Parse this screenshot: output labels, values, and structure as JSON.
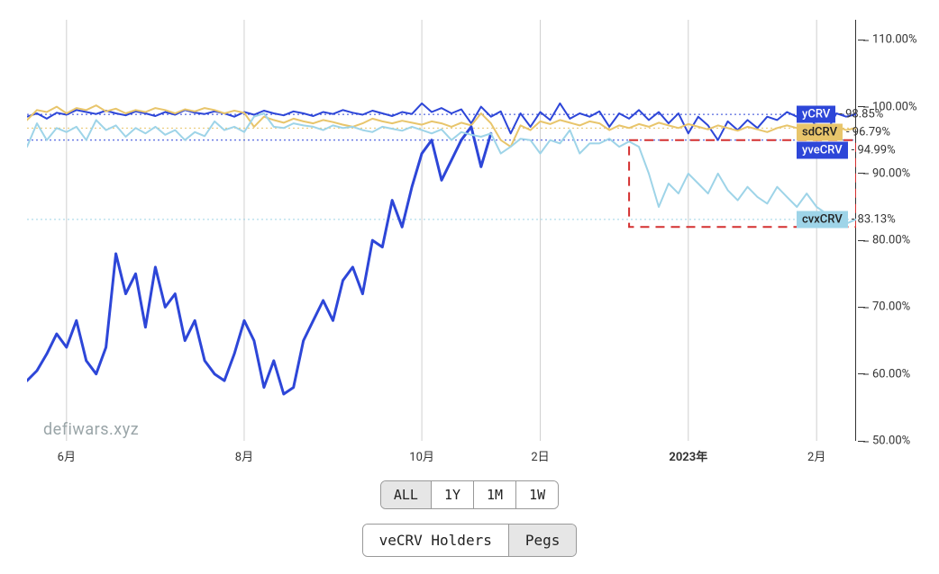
{
  "watermark": "defiwars.xyz",
  "axes": {
    "y": {
      "ticks": [
        {
          "v": 110,
          "label": "110.00%"
        },
        {
          "v": 100,
          "label": "100.00%"
        },
        {
          "v": 90,
          "label": "90.00%"
        },
        {
          "v": 80,
          "label": "80.00%"
        },
        {
          "v": 70,
          "label": "70.00%"
        },
        {
          "v": 60,
          "label": "60.00%"
        },
        {
          "v": 50,
          "label": "50.00%"
        }
      ],
      "min": 50,
      "max": 113
    },
    "x": {
      "ticks": [
        {
          "i": 4,
          "label": "6月"
        },
        {
          "i": 22,
          "label": "8月"
        },
        {
          "i": 40,
          "label": "10月"
        },
        {
          "i": 52,
          "label": "2日"
        },
        {
          "i": 67,
          "label": "2023年",
          "bold": true
        },
        {
          "i": 80,
          "label": "2月"
        }
      ],
      "grid_i": [
        4,
        22,
        40,
        52,
        67,
        80
      ],
      "n": 85
    }
  },
  "annotation_box": {
    "x0": 61,
    "x1": 84,
    "y0": 82,
    "y1": 95
  },
  "range_buttons": [
    {
      "label": "ALL",
      "selected": true
    },
    {
      "label": "1Y",
      "selected": false
    },
    {
      "label": "1M",
      "selected": false
    },
    {
      "label": "1W",
      "selected": false
    }
  ],
  "tabs": [
    {
      "label": "veCRV Holders",
      "selected": false
    },
    {
      "label": "Pegs",
      "selected": true
    }
  ],
  "chart_data": {
    "type": "line",
    "title": "",
    "xlabel": "",
    "ylabel": "",
    "ylim": [
      50,
      113
    ],
    "x_index": {
      "start": 0,
      "end": 84,
      "step": 1
    },
    "series": [
      {
        "name": "yCRV",
        "color": "#2d46d8",
        "last_value": 98.85,
        "last_label": "98.85%",
        "values": [
          98.5,
          99.0,
          98.2,
          99.1,
          98.8,
          99.5,
          99.2,
          98.9,
          99.4,
          99.0,
          98.7,
          99.3,
          99.0,
          98.6,
          99.2,
          98.8,
          99.5,
          99.1,
          98.9,
          99.3,
          99.0,
          98.5,
          99.2,
          98.8,
          99.4,
          99.0,
          98.7,
          99.3,
          99.0,
          98.6,
          99.2,
          98.9,
          99.5,
          99.1,
          98.8,
          99.4,
          99.0,
          98.6,
          99.2,
          98.9,
          100.5,
          99.2,
          99.8,
          99.0,
          99.6,
          97.5,
          100.0,
          98.5,
          99.3,
          96.0,
          99.0,
          97.0,
          99.2,
          98.0,
          100.5,
          98.2,
          99.0,
          98.5,
          99.3,
          97.0,
          99.0,
          98.2,
          99.5,
          98.0,
          99.2,
          97.5,
          99.0,
          96.0,
          98.5,
          97.2,
          95.0,
          97.8,
          96.5,
          98.0,
          96.8,
          98.5,
          98.0,
          99.2,
          98.5,
          99.0,
          97.0,
          96.2,
          99.0,
          98.5,
          98.85
        ]
      },
      {
        "name": "sdCRV",
        "color": "#e8c56b",
        "last_value": 96.79,
        "last_label": "96.79%",
        "values": [
          98.0,
          99.5,
          99.2,
          100.0,
          99.0,
          99.8,
          99.5,
          100.2,
          99.3,
          99.7,
          99.0,
          99.5,
          99.2,
          99.8,
          99.5,
          99.0,
          99.6,
          99.3,
          99.8,
          99.5,
          99.0,
          99.4,
          99.1,
          97.0,
          98.5,
          98.0,
          97.6,
          98.2,
          97.8,
          97.5,
          98.0,
          97.7,
          97.3,
          97.0,
          97.5,
          98.2,
          97.8,
          97.5,
          97.9,
          97.6,
          97.3,
          97.8,
          97.5,
          97.0,
          97.6,
          97.2,
          99.0,
          97.5,
          95.0,
          94.0,
          97.2,
          96.5,
          97.8,
          97.4,
          98.0,
          97.6,
          97.2,
          97.8,
          97.5,
          96.5,
          97.2,
          96.8,
          97.4,
          97.0,
          97.6,
          97.2,
          96.8,
          97.4,
          97.0,
          96.6,
          97.2,
          96.8,
          96.4,
          97.0,
          96.6,
          96.2,
          96.8,
          97.2,
          96.8,
          96.4,
          97.0,
          96.6,
          97.0,
          96.5,
          96.79
        ]
      },
      {
        "name": "yveCRV",
        "color": "#2d46d8",
        "last_value": 94.99,
        "last_label": "94.99%",
        "values": [
          59.0,
          60.5,
          63.0,
          66.0,
          64.0,
          68.0,
          62.0,
          60.0,
          64.0,
          78.0,
          72.0,
          75.0,
          67.0,
          76.0,
          70.0,
          72.0,
          65.0,
          68.0,
          62.0,
          60.0,
          59.0,
          63.0,
          68.0,
          65.0,
          58.0,
          62.0,
          57.0,
          58.0,
          65.0,
          68.0,
          71.0,
          68.0,
          74.0,
          76.0,
          72.0,
          80.0,
          79.0,
          86.0,
          82.0,
          88.0,
          93.0,
          95.0,
          89.0,
          92.0,
          95.0,
          97.0,
          91.0,
          96.0,
          null,
          null,
          null,
          null,
          null,
          null,
          null,
          null,
          null,
          null,
          null,
          null,
          null,
          null,
          null,
          null,
          null,
          null,
          null,
          null,
          null,
          null,
          null,
          null,
          null,
          null,
          null,
          null,
          null,
          null,
          null,
          null,
          null,
          null,
          null,
          null,
          94.99
        ]
      },
      {
        "name": "cvxCRV",
        "color": "#9ed4e8",
        "last_value": 83.13,
        "last_label": "83.13%",
        "values": [
          94.0,
          97.5,
          95.0,
          96.8,
          96.2,
          97.0,
          95.0,
          98.0,
          96.5,
          97.2,
          95.5,
          96.8,
          96.0,
          97.0,
          95.8,
          96.5,
          95.0,
          96.2,
          95.6,
          97.8,
          96.5,
          97.0,
          96.2,
          98.5,
          99.0,
          97.0,
          96.8,
          97.5,
          97.2,
          97.0,
          96.5,
          97.2,
          96.8,
          97.0,
          96.5,
          96.2,
          97.0,
          96.7,
          96.4,
          97.0,
          96.5,
          96.0,
          96.6,
          95.0,
          96.2,
          95.8,
          95.5,
          96.0,
          93.0,
          94.0,
          95.2,
          95.0,
          93.0,
          95.0,
          94.5,
          96.5,
          93.0,
          94.5,
          94.5,
          95.2,
          94.0,
          94.8,
          94.0,
          90.0,
          85.0,
          88.5,
          87.0,
          90.0,
          88.5,
          87.0,
          90.0,
          87.5,
          86.0,
          88.0,
          86.5,
          85.5,
          88.0,
          86.5,
          85.0,
          87.0,
          85.0,
          84.0,
          83.0,
          82.5,
          83.13
        ]
      }
    ],
    "legend_position": "right"
  }
}
